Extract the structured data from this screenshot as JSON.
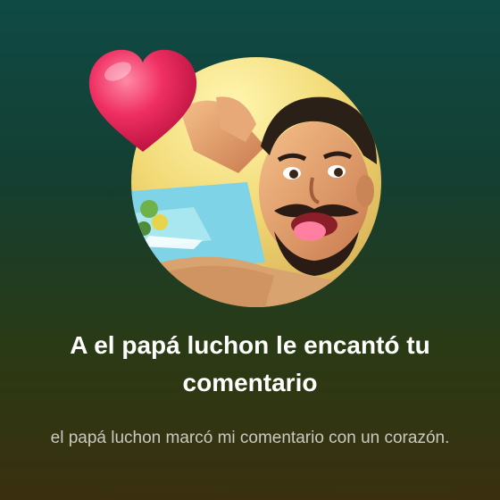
{
  "notification": {
    "headline": "A el papá luchon le encantó tu comentario",
    "subtitle": "el papá luchon marcó mi comentario con un corazón."
  },
  "icons": {
    "reaction": "heart-icon",
    "profile": "avatar"
  },
  "colors": {
    "background_top": "#0f4a45",
    "background_bottom": "#3a3010",
    "heart": "#ef2f62",
    "headline": "#ffffff",
    "subtitle": "#c9c9c0"
  }
}
